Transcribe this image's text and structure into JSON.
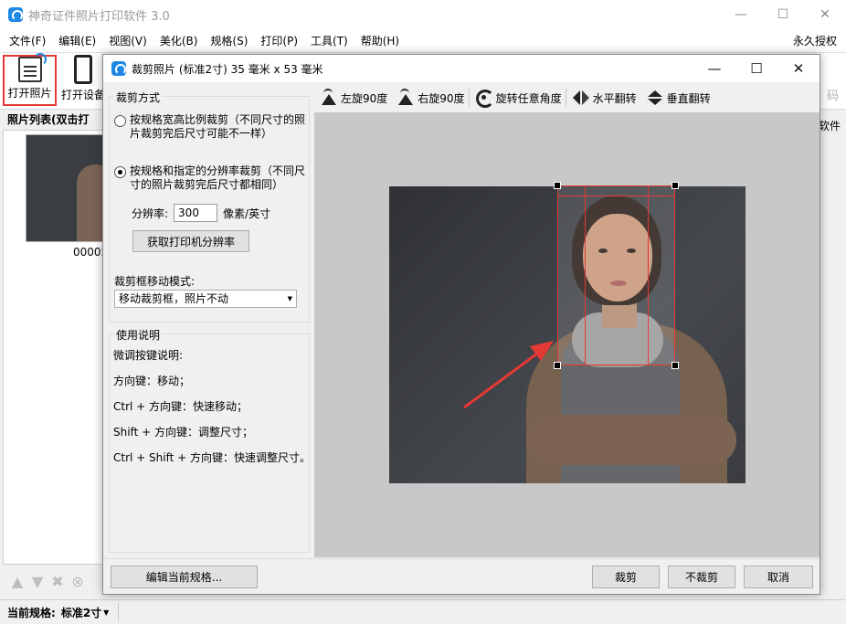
{
  "app": {
    "title": "神奇证件照片打印软件 3.0",
    "window_controls": {
      "minimize": "—",
      "maximize": "☐",
      "close": "✕"
    }
  },
  "menubar": {
    "items": [
      "文件(F)",
      "编辑(E)",
      "视图(V)",
      "美化(B)",
      "规格(S)",
      "打印(P)",
      "工具(T)",
      "帮助(H)"
    ],
    "license": "永久授权"
  },
  "toolbar": {
    "open_photo": "打开照片",
    "open_device": "打开设备",
    "right_ghost": "码"
  },
  "photo_list": {
    "header": "照片列表(双击打开)",
    "thumb_label": "00005"
  },
  "right_panel": {
    "header": "软件"
  },
  "statusbar": {
    "label": "当前规格:",
    "value": "标准2寸"
  },
  "dialog": {
    "title": "裁剪照片 (标准2寸) 35 毫米 x 53 毫米",
    "controls": {
      "minimize": "—",
      "maximize": "☐",
      "close": "✕"
    },
    "crop_mode": {
      "group_title": "裁剪方式",
      "option1": "按规格宽高比例裁剪（不同尺寸的照片裁剪完后尺寸可能不一样）",
      "option2": "按规格和指定的分辨率裁剪（不同尺寸的照片裁剪完后尺寸都相同）",
      "selected": 2,
      "resolution_label": "分辨率:",
      "resolution_value": "300",
      "resolution_unit": "像素/英寸",
      "get_printer_button": "获取打印机分辨率",
      "move_mode_label": "裁剪框移动模式:",
      "move_mode_value": "移动裁剪框，照片不动"
    },
    "help": {
      "title": "使用说明",
      "lines": [
        "微调按键说明:",
        "方向键：移动；",
        "Ctrl + 方向键：快速移动；",
        "Shift + 方向键：调整尺寸；",
        "Ctrl + Shift + 方向键：快速调整尺寸。"
      ]
    },
    "image_toolbar": {
      "rotate_left": "左旋90度",
      "rotate_right": "右旋90度",
      "rotate_any": "旋转任意角度",
      "flip_h": "水平翻转",
      "flip_v": "垂直翻转"
    },
    "buttons": {
      "edit_spec": "编辑当前规格...",
      "crop": "裁剪",
      "no_crop": "不裁剪",
      "cancel": "取消"
    }
  },
  "colors": {
    "accent": "#1e88e5",
    "highlight_red": "#e53935",
    "canvas_bg": "#c8c8c8"
  },
  "icons": [
    "app-icon",
    "open-photo-icon",
    "phone-icon",
    "rotate-left-icon",
    "rotate-right-icon",
    "rotate-any-icon",
    "flip-horizontal-icon",
    "flip-vertical-icon",
    "arrow-up-icon",
    "arrow-down-icon",
    "delete-icon",
    "close-circle-icon"
  ]
}
